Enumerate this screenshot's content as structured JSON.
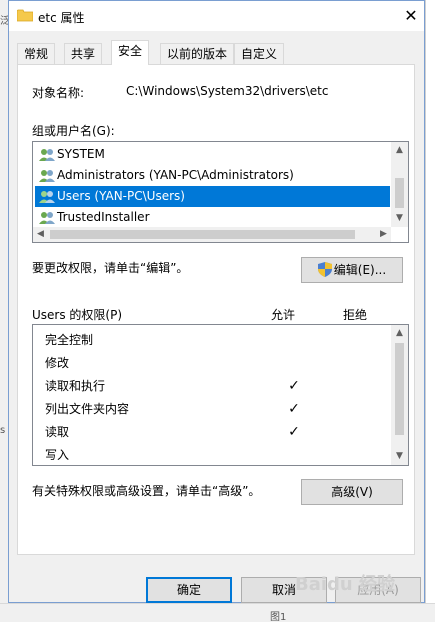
{
  "window": {
    "title": "etc 属性",
    "close_glyph": "✕"
  },
  "tabs": [
    {
      "label": "常规"
    },
    {
      "label": "共享"
    },
    {
      "label": "安全"
    },
    {
      "label": "以前的版本"
    },
    {
      "label": "自定义"
    }
  ],
  "active_tab": "安全",
  "object": {
    "label": "对象名称:",
    "value": "C:\\Windows\\System32\\drivers\\etc"
  },
  "groups": {
    "label": "组或用户名(G):",
    "items": [
      {
        "name": "SYSTEM",
        "selected": false
      },
      {
        "name": "Administrators (YAN-PC\\Administrators)",
        "selected": false
      },
      {
        "name": "Users (YAN-PC\\Users)",
        "selected": true
      },
      {
        "name": "TrustedInstaller",
        "selected": false
      }
    ]
  },
  "edit_hint": "要更改权限，请单击“编辑”。",
  "edit_button": "编辑(E)...",
  "permissions": {
    "title": "Users 的权限(P)",
    "allow_header": "允许",
    "deny_header": "拒绝",
    "check_glyph": "✓",
    "rows": [
      {
        "name": "完全控制",
        "allow": false,
        "deny": false
      },
      {
        "name": "修改",
        "allow": false,
        "deny": false
      },
      {
        "name": "读取和执行",
        "allow": true,
        "deny": false
      },
      {
        "name": "列出文件夹内容",
        "allow": true,
        "deny": false
      },
      {
        "name": "读取",
        "allow": true,
        "deny": false
      },
      {
        "name": "写入",
        "allow": false,
        "deny": false
      }
    ]
  },
  "advanced_hint": "有关特殊权限或高级设置，请单击“高级”。",
  "advanced_button": "高级(V)",
  "footer": {
    "ok": "确定",
    "cancel": "取消",
    "apply": "应用(A)"
  },
  "background": {
    "left_char_1": "泛",
    "left_char_2": "s",
    "bottom_text": "图1"
  },
  "watermark": "Baidu 经验",
  "colors": {
    "accent": "#0078d7",
    "selection": "#0078d7",
    "dialog_bg": "#f0f0f0",
    "border": "#adadad"
  },
  "icons": [
    "folder-icon",
    "close-icon",
    "user-group-icon",
    "shield-icon",
    "check-icon",
    "arrow-up-icon",
    "arrow-down-icon",
    "arrow-left-icon",
    "arrow-right-icon"
  ]
}
